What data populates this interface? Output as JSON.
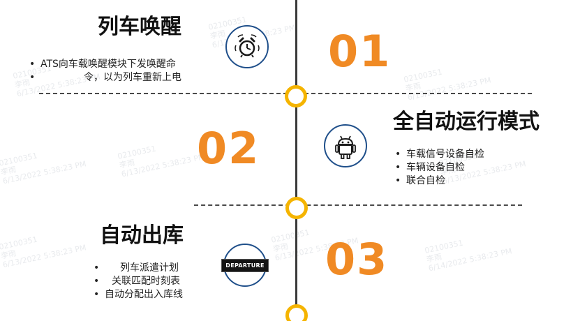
{
  "steps": [
    {
      "number": "01",
      "title": "列车唤醒",
      "icon": "alarm-clock-icon",
      "bullets": [
        "ATS向车载唤醒模块下发唤醒命",
        "令，以为列车重新上电"
      ]
    },
    {
      "number": "02",
      "title": "全自动运行模式",
      "icon": "robot-icon",
      "bullets": [
        "车载信号设备自检",
        "车辆设备自检",
        "联合自检"
      ]
    },
    {
      "number": "03",
      "title": "自动出库",
      "icon": "departure-sign-icon",
      "icon_text": "DEPARTURE",
      "bullets": [
        "列车派遣计划",
        "关联匹配时刻表",
        "自动分配出入库线"
      ]
    }
  ],
  "colors": {
    "accent_orange": "#f08a24",
    "node_yellow": "#f5b400",
    "icon_blue": "#1f4f8a"
  }
}
